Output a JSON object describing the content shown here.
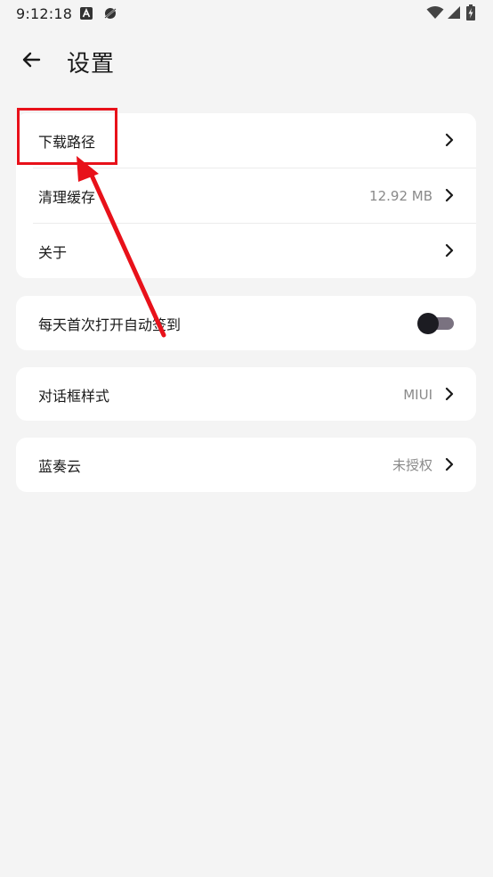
{
  "status_bar": {
    "time": "9:12:18",
    "icons": [
      "font-a-icon",
      "do-not-disturb-icon",
      "wifi-icon",
      "signal-icon",
      "battery-charging-icon"
    ]
  },
  "header": {
    "back_icon": "arrow-left-icon",
    "title": "设置"
  },
  "groups": [
    {
      "items": [
        {
          "label": "下载路径",
          "value": "",
          "chevron": true
        },
        {
          "label": "清理缓存",
          "value": "12.92 MB",
          "chevron": true
        },
        {
          "label": "关于",
          "value": "",
          "chevron": true
        }
      ]
    },
    {
      "items": [
        {
          "label": "每天首次打开自动签到",
          "toggle": false
        }
      ]
    },
    {
      "items": [
        {
          "label": "对话框样式",
          "value": "MIUI",
          "chevron": true
        }
      ]
    },
    {
      "items": [
        {
          "label": "蓝奏云",
          "value": "未授权",
          "chevron": true
        }
      ]
    }
  ],
  "annotation": {
    "color": "#e8111a"
  }
}
